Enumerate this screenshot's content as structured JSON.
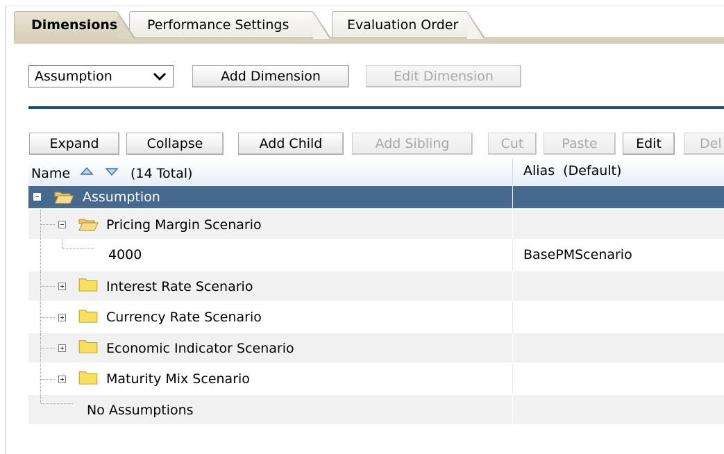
{
  "tabs": [
    "Dimensions",
    "Performance Settings",
    "Evaluation Order"
  ],
  "dimension_select": {
    "value": "Assumption"
  },
  "top_buttons": {
    "add_dimension": "Add Dimension",
    "edit_dimension": "Edit Dimension"
  },
  "toolbar": {
    "expand": "Expand",
    "collapse": "Collapse",
    "add_child": "Add Child",
    "add_sibling": "Add Sibling",
    "cut": "Cut",
    "paste": "Paste",
    "edit": "Edit",
    "delete_partial": "Del"
  },
  "table": {
    "name_header": "Name",
    "total": "(14 Total)",
    "alias_header": "Alias  (Default)",
    "rows": [
      {
        "name": "Assumption",
        "alias": ""
      },
      {
        "name": "Pricing Margin Scenario",
        "alias": ""
      },
      {
        "name": "4000",
        "alias": "BasePMScenario"
      },
      {
        "name": "Interest Rate Scenario",
        "alias": ""
      },
      {
        "name": "Currency Rate Scenario",
        "alias": ""
      },
      {
        "name": "Economic Indicator Scenario",
        "alias": ""
      },
      {
        "name": "Maturity Mix Scenario",
        "alias": ""
      },
      {
        "name": "No Assumptions",
        "alias": ""
      }
    ]
  },
  "colors": {
    "selected_row": "#46698f",
    "separator": "#1f4b80",
    "tab_active": "#d7cfb7"
  },
  "icons": [
    "sort-up-icon",
    "sort-down-icon",
    "folder-open-icon",
    "folder-icon",
    "collapse-icon",
    "expand-icon"
  ]
}
